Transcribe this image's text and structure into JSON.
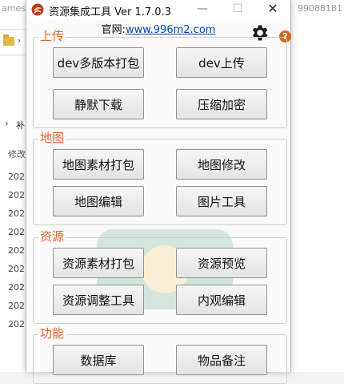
{
  "window": {
    "title": "资源集成工具 Ver 1.7.0.3",
    "minimize_symbol": "—",
    "maximize_symbol": "☐",
    "close_symbol": "✕"
  },
  "header": {
    "site_label": "官网:",
    "site_url": "www.996m2.com",
    "help_symbol": "?"
  },
  "groups": [
    {
      "title": "上传",
      "buttons": [
        "dev多版本打包",
        "dev上传",
        "静默下载",
        "压缩加密"
      ]
    },
    {
      "title": "地图",
      "buttons": [
        "地图素材打包",
        "地图修改",
        "地图编辑",
        "图片工具"
      ]
    },
    {
      "title": "资源",
      "buttons": [
        "资源素材打包",
        "资源预览",
        "资源调整工具",
        "内观编辑"
      ]
    },
    {
      "title": "功能",
      "buttons": [
        "数据库",
        "物品备注"
      ]
    }
  ],
  "background": {
    "ghost_left": "ames",
    "ghost_right": "99088181",
    "row_label": "补",
    "column_header": "修改",
    "dates": [
      "202",
      "202",
      "202",
      "202",
      "202",
      "202",
      "202",
      "202",
      "202"
    ]
  },
  "colors": {
    "group_title": "#e5672b",
    "link": "#0645ad"
  }
}
